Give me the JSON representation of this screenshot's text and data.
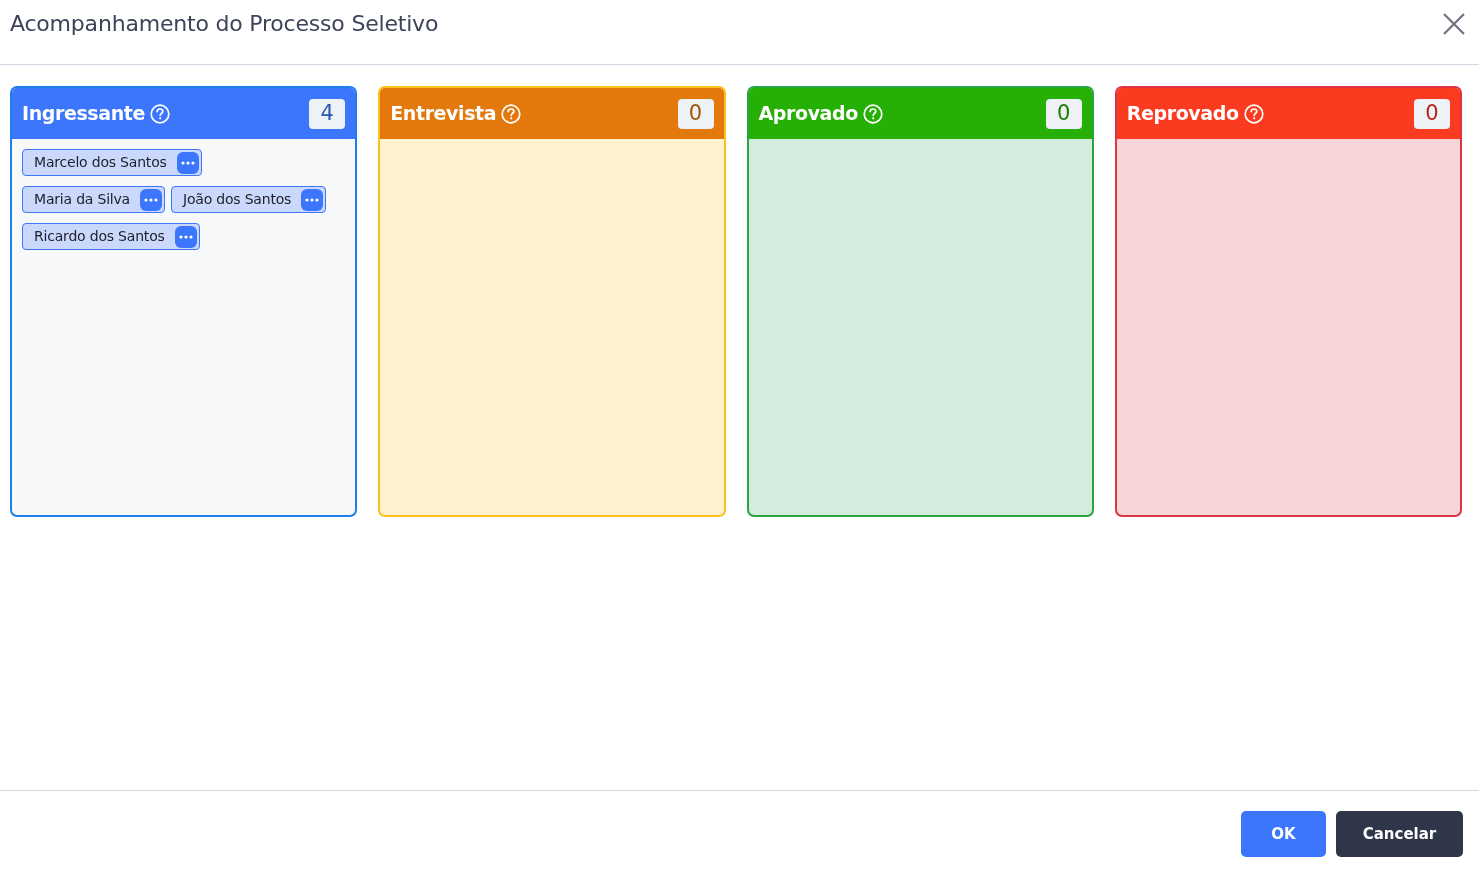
{
  "dialog": {
    "title": "Acompanhamento do Processo Seletivo"
  },
  "columns": [
    {
      "title": "Ingressante",
      "count": "4",
      "color": "#3b76fc",
      "candidates": [
        "Marcelo dos Santos",
        "Maria da Silva",
        "João dos Santos",
        "Ricardo dos Santos"
      ]
    },
    {
      "title": "Entrevista",
      "count": "0",
      "color": "#e3780c"
    },
    {
      "title": "Aprovado",
      "count": "0",
      "color": "#26b005"
    },
    {
      "title": "Reprovado",
      "count": "0",
      "color": "#fb3b20"
    }
  ],
  "buttons": [
    {
      "label": "OK",
      "kind": "primary"
    },
    {
      "label": "Cancelar",
      "kind": "dark"
    }
  ]
}
